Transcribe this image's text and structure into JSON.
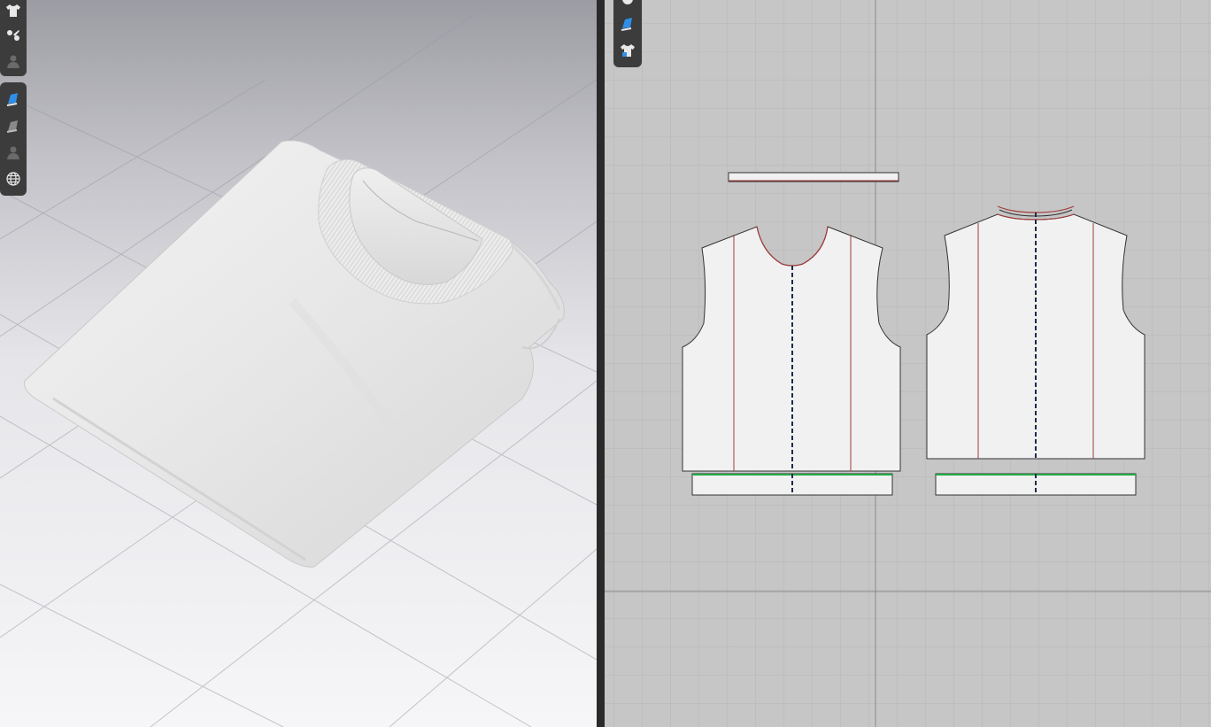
{
  "app": {
    "views": [
      "3d-view",
      "2d-pattern-view"
    ]
  },
  "toolbar3d": {
    "groups": [
      {
        "items": [
          {
            "name": "garment-display-icon",
            "active": false
          },
          {
            "name": "avatar-props-icon",
            "active": false
          },
          {
            "name": "avatar-display-icon",
            "active": false
          }
        ]
      },
      {
        "items": [
          {
            "name": "fabric-texture-icon",
            "active": true
          },
          {
            "name": "render-quality-icon",
            "active": false
          },
          {
            "name": "avatar-silhouette-icon",
            "active": false
          },
          {
            "name": "wireframe-globe-icon",
            "active": false
          }
        ]
      }
    ]
  },
  "toolbar2d": {
    "items": [
      {
        "name": "pattern-info-icon",
        "active": false
      },
      {
        "name": "fabric-texture-icon",
        "active": true
      },
      {
        "name": "garment-display-icon",
        "active": false
      }
    ]
  },
  "colors": {
    "accent": "#2f8fe8",
    "toolbar_bg": "#3c3c3c",
    "grid_bg_2d": "#c6c6c6",
    "pattern_fill": "#f1f1f1",
    "seam_red": "#a33a3a",
    "notch_line_green": "#22aa44",
    "grain_line": "#1e2a4a"
  },
  "patterns": [
    {
      "name": "neck-binding-strip"
    },
    {
      "name": "front-bodice"
    },
    {
      "name": "back-bodice"
    },
    {
      "name": "front-hem-band"
    },
    {
      "name": "back-hem-band"
    }
  ]
}
